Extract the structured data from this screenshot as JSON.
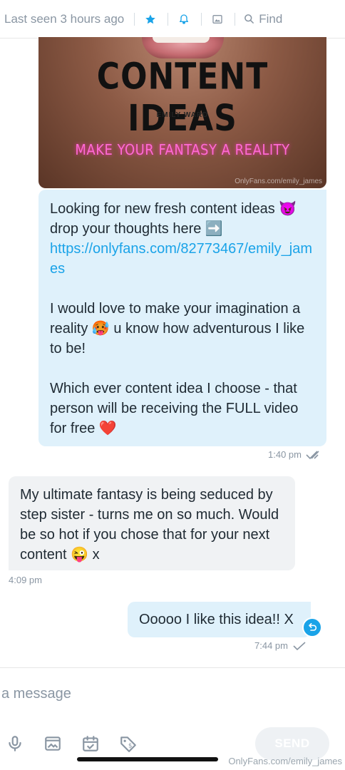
{
  "header": {
    "last_seen": "Last seen 3 hours ago",
    "find_label": "Find",
    "icons": [
      "star-icon",
      "bell-icon",
      "image-icon",
      "search-icon"
    ]
  },
  "image_message": {
    "title": "CONTENT IDEAS",
    "author": "EMILY WARD",
    "tagline": "MAKE YOUR FANTASY A REALITY",
    "watermark": "OnlyFans.com/emily_james"
  },
  "messages": [
    {
      "direction": "outgoing",
      "line1": "Looking for new fresh content ideas",
      "emoji1": "😈",
      "line2": " drop your thoughts here ",
      "emoji2": "➡️",
      "link": "https://onlyfans.com/82773467/emily_james",
      "para2": "I would love to make your imagination a reality ",
      "emoji3": "🥵",
      "para2b": " u know how adventurous I like to be!",
      "para3": "Which ever content idea I choose - that person will be receiving the FULL video for free ",
      "emoji4": "❤️",
      "time": "1:40 pm"
    },
    {
      "direction": "incoming",
      "text": "My ultimate fantasy is being seduced by step sister - turns me on so much. Would be so hot if you chose that for your next content ",
      "emoji": "😜",
      "suffix": " x",
      "time": "4:09 pm"
    },
    {
      "direction": "outgoing",
      "text": "Ooooo I like this idea!! X",
      "time": "7:44 pm"
    }
  ],
  "composer": {
    "placeholder": "a message",
    "send_label": "SEND",
    "tools": [
      "microphone-icon",
      "media-icon",
      "calendar-icon",
      "price-tag-icon"
    ]
  },
  "footer_watermark": "OnlyFans.com/emily_james",
  "colors": {
    "accent": "#1aa3e8",
    "outgoing_bubble": "#dff1fb",
    "incoming_bubble": "#f0f2f4",
    "muted_text": "#8a96a3"
  }
}
